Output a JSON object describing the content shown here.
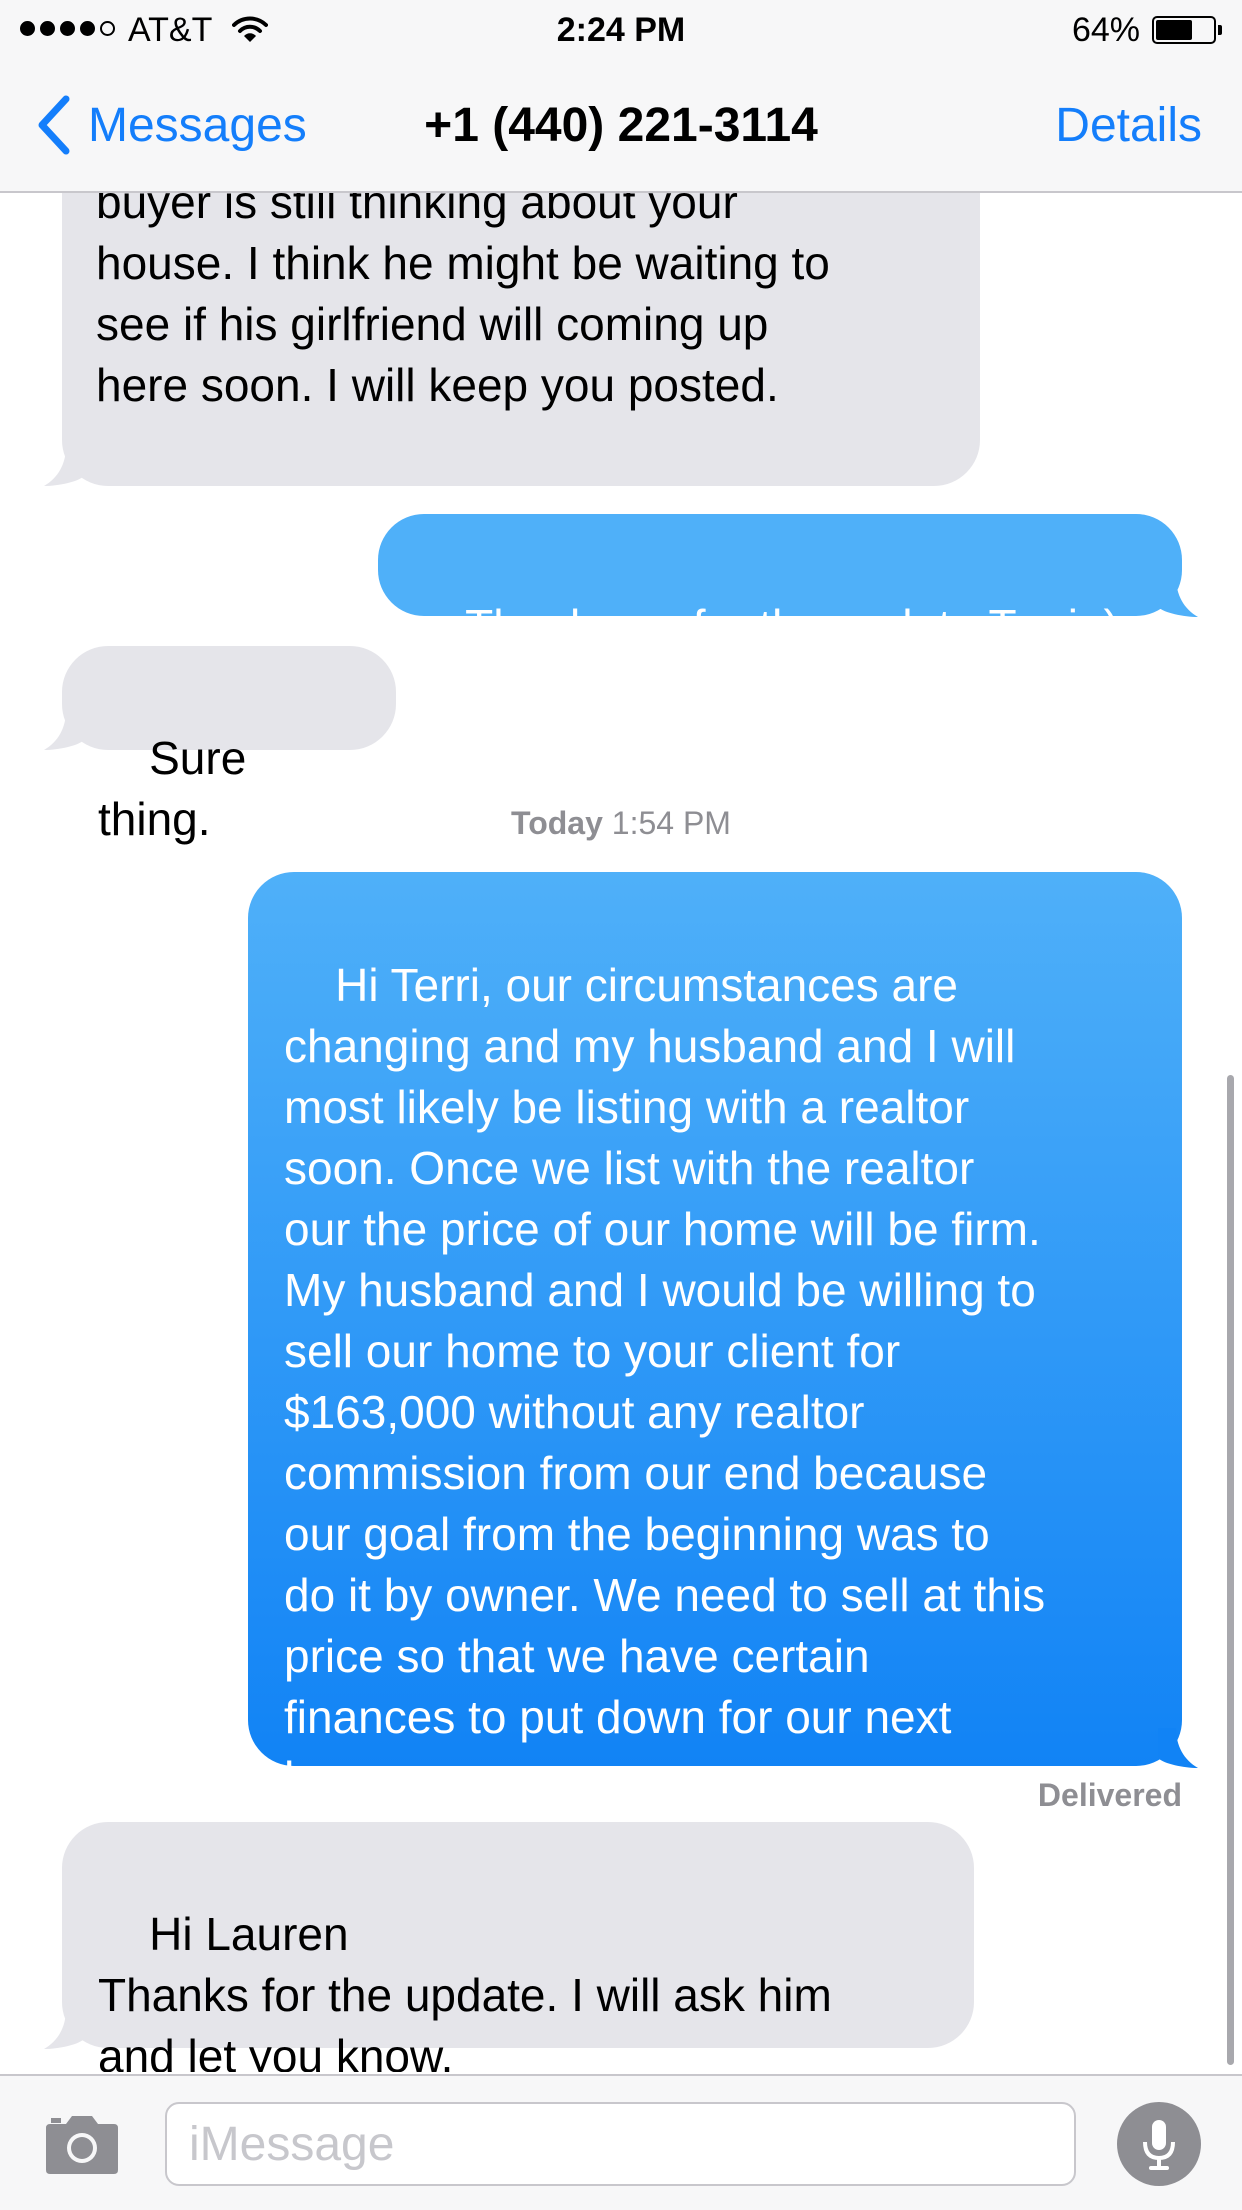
{
  "status_bar": {
    "carrier": "AT&T",
    "time": "2:24 PM",
    "battery_percent": "64%",
    "battery_level": 0.64,
    "signal_bars_filled": 4,
    "signal_bars_total": 5
  },
  "nav": {
    "back_label": "Messages",
    "title": "+1 (440) 221-3114",
    "details_label": "Details"
  },
  "messages": [
    {
      "direction": "incoming",
      "text": "I wanted to let you know that my\nbuyer is still thinking about your\nhouse. I think he might be waiting to\nsee if his girlfriend will coming up\nhere soon. I will keep you posted."
    },
    {
      "direction": "outgoing",
      "text": "Thank you for the update Terri :)"
    },
    {
      "direction": "incoming",
      "text": "Sure thing."
    },
    {
      "direction": "outgoing",
      "text": "Hi Terri, our circumstances are\nchanging and my husband and I will\nmost likely be listing with a realtor\nsoon. Once we list with the realtor\nour the price of our home will be firm.\nMy husband and I would be willing to\nsell our home to your client for\n$163,000 without any realtor\ncommission from our end because\nour goal from the beginning was to\ndo it by owner. We need to sell at this\nprice so that we have certain\nfinances to put down for our next\nhome."
    },
    {
      "direction": "incoming",
      "text": "Hi Lauren\nThanks for the update. I will ask him\nand let you know."
    }
  ],
  "timestamp": {
    "day": "Today",
    "time": "1:54 PM"
  },
  "delivered_label": "Delivered",
  "input": {
    "placeholder": "iMessage"
  },
  "icons": {
    "back": "chevron-left-icon",
    "wifi": "wifi-icon",
    "battery": "battery-icon",
    "camera": "camera-icon",
    "mic": "microphone-icon"
  },
  "colors": {
    "accent": "#147efb",
    "incoming_bubble": "#e5e5ea",
    "outgoing_bubble_top": "#4fb0f9",
    "outgoing_bubble_bottom": "#1183f5",
    "meta_text": "#8e8e93",
    "bar_background": "#f7f7f8"
  }
}
